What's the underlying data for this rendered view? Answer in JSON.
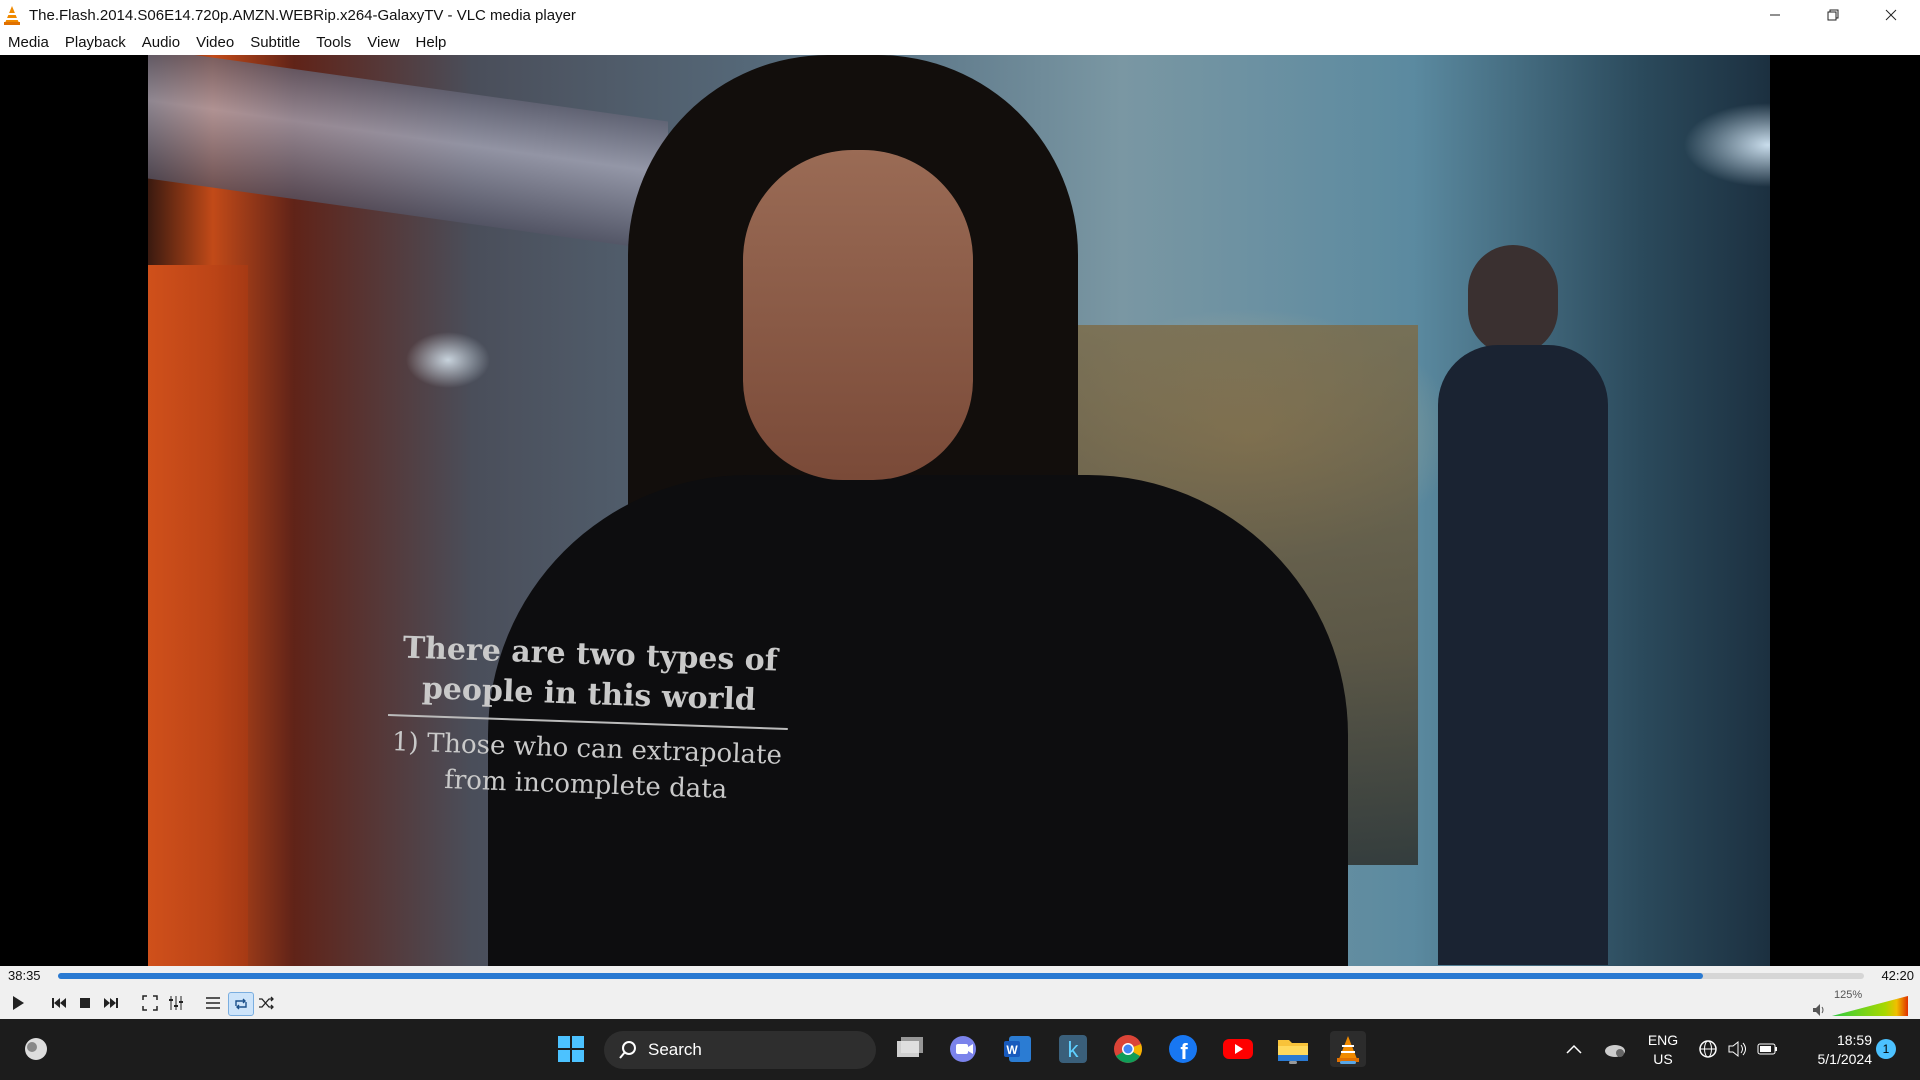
{
  "window": {
    "title": "The.Flash.2014.S06E14.720p.AMZN.WEBRip.x264-GalaxyTV - VLC media player"
  },
  "menu": [
    "Media",
    "Playback",
    "Audio",
    "Video",
    "Subtitle",
    "Tools",
    "View",
    "Help"
  ],
  "video": {
    "shirt_line1": "There are two types of",
    "shirt_line2": "people in this world",
    "shirt_line3": "1) Those who can extrapolate",
    "shirt_line4": "from incomplete data"
  },
  "player": {
    "elapsed": "38:35",
    "total": "42:20",
    "progress_fraction": 0.911,
    "volume_label": "125%",
    "volume_fraction": 1.0
  },
  "taskbar": {
    "search_label": "Search",
    "language": "ENG",
    "region": "US",
    "time": "18:59",
    "date": "5/1/2024",
    "notification_count": "1"
  },
  "colors": {
    "accent": "#2a7ad2",
    "vlc_orange": "#f08a00",
    "taskbar": "#1c1c1c"
  }
}
